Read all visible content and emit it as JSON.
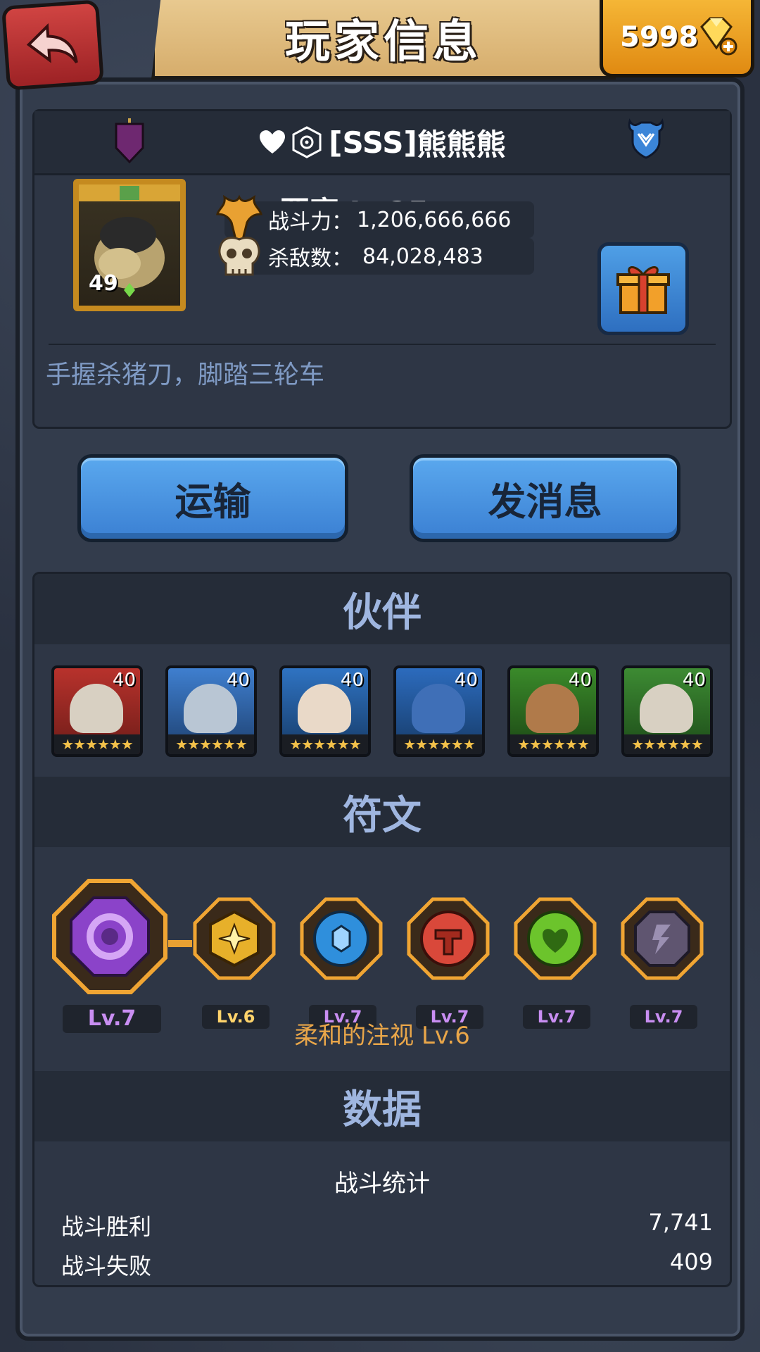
{
  "header": {
    "title": "玩家信息",
    "gems": "5998"
  },
  "player": {
    "name_prefix": "[SSS]",
    "name": "熊熊熊",
    "avatar_level": "49",
    "rank": "要塞 Lv25",
    "power_label": "战斗力：",
    "power_value": "1,206,666,666",
    "kills_label": "杀敌数：",
    "kills_value": "84,028,483",
    "motto": "手握杀猪刀，脚踏三轮车"
  },
  "actions": {
    "transport": "运输",
    "message": "发消息"
  },
  "sections": {
    "companions": "伙伴",
    "runes": "符文",
    "data": "数据"
  },
  "companions": [
    {
      "level": "40",
      "stars": "★★★★★★",
      "color": "#b8322c"
    },
    {
      "level": "40",
      "stars": "★★★★★★",
      "color": "#3f7fcf"
    },
    {
      "level": "40",
      "stars": "★★★★★★",
      "color": "#2f73c2"
    },
    {
      "level": "40",
      "stars": "★★★★★★",
      "color": "#2c6bbd"
    },
    {
      "level": "40",
      "stars": "★★★★★★",
      "color": "#3a8a2a"
    },
    {
      "level": "40",
      "stars": "★★★★★★",
      "color": "#3d8b33"
    }
  ],
  "runes": {
    "items": [
      {
        "level": "Lv.7",
        "color": "#8b43c9",
        "level_color": "#d79bff"
      },
      {
        "level": "Lv.6",
        "color": "#e7b02a",
        "level_color": "#ffd36b"
      },
      {
        "level": "Lv.7",
        "color": "#2f8fdc",
        "level_color": "#d79bff"
      },
      {
        "level": "Lv.7",
        "color": "#d9483a",
        "level_color": "#d79bff"
      },
      {
        "level": "Lv.7",
        "color": "#6cc42c",
        "level_color": "#d79bff"
      },
      {
        "level": "Lv.7",
        "color": "#5f5570",
        "level_color": "#d79bff"
      }
    ],
    "selected_name": "柔和的注视 Lv.6"
  },
  "data": {
    "subtitle": "战斗统计",
    "rows": [
      {
        "label": "战斗胜利",
        "value": "7,741"
      },
      {
        "label": "战斗失败",
        "value": "409"
      }
    ]
  },
  "colors": {
    "panel": "#2e3645",
    "header_bg": "#252c38",
    "accent_blue": "#4a95e2",
    "gold": "#e9a649"
  }
}
